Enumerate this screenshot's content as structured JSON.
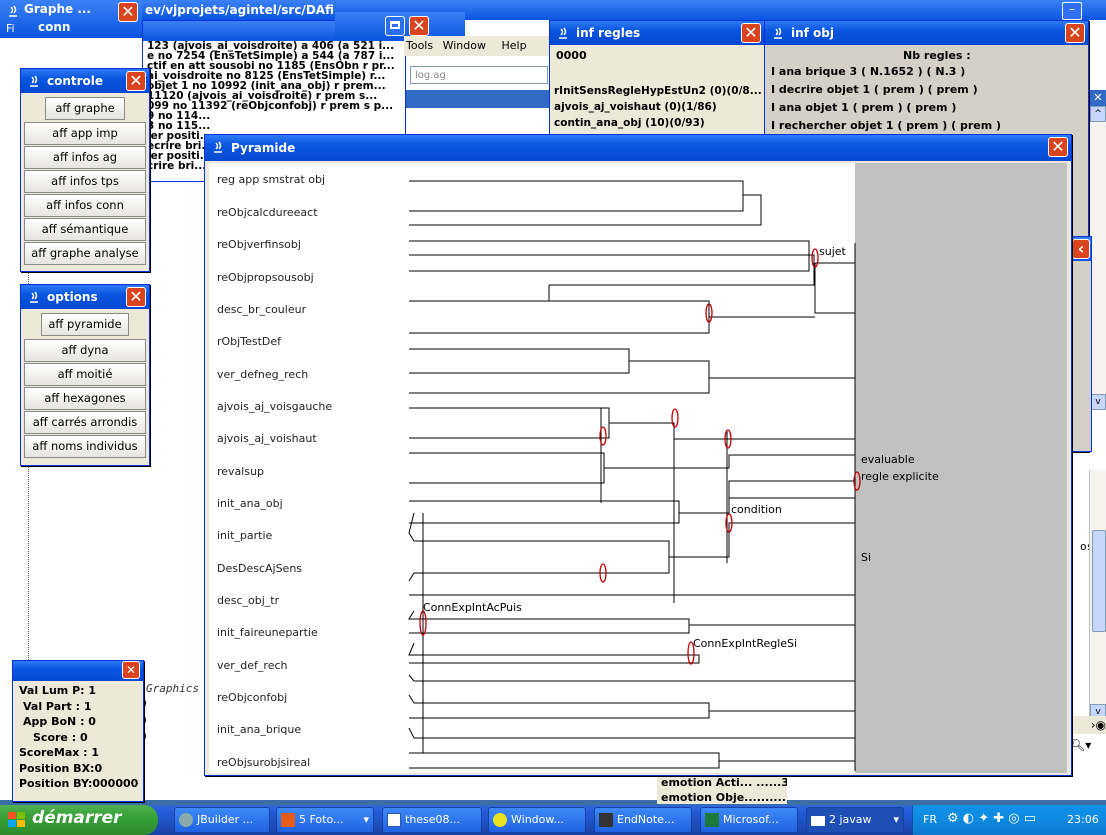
{
  "background_window": {
    "graphe_title": "Graphe ...",
    "path_text": "ev/vjprojets/agintel/src/DAfi",
    "conn_title": "conn",
    "conn_log_lines": [
      "123 (ajvois_ai_voisdroite) a 406 (a 521 i...",
      "e no 7254 (EnsTetSimple) a 544 (a 787 i...",
      "ctif en att sousobi no 1185 (EnsObn r pr...",
      " ai_voisdroite no 8125 (EnsTetSimple) r...",
      "objet 1 no 10992 (init_ana_obj) r prem...",
      "11120 (ajvois_ai_voisdroite) r prem s...",
      "099 no 11392 (reObjconfobj) r prem s p...",
      "9 no 114...",
      "3 no 115...",
      "ler positi...",
      "ecrire bri...",
      "ler positi...",
      "crire bri..."
    ],
    "tools_menu": [
      "Tools",
      "Window",
      "Help"
    ],
    "log_field": "log.ag",
    "fi_label": "Fi",
    "graphics_code": "Graphics g)",
    "code_lines": [
      "0",
      "0",
      "0"
    ],
    "right_code": "osy"
  },
  "inf_regles": {
    "title": "inf regles",
    "header": "0000",
    "lines": [
      "rInitSensRegleHypEstUn2 (0)(0/8...",
      "ajvois_aj_voishaut (0)(1/86)",
      "contin_ana_obj (10)(0/93)"
    ]
  },
  "inf_obj": {
    "title": "inf obj",
    "header": "Nb regles :",
    "lines": [
      "I ana brique 3 ( N.1652 )  ( N.3 )",
      "I decrire objet 1 ( prem )  ( prem )",
      "I ana objet 1 ( prem )  ( prem )",
      "I rechercher objet 1 ( prem )  ( prem )"
    ]
  },
  "controle": {
    "title": "controle",
    "buttons": [
      "aff graphe",
      "aff app imp",
      "aff infos ag",
      "aff infos tps",
      "aff infos conn",
      "aff sémantique",
      "aff graphe analyse"
    ]
  },
  "options": {
    "title": "options",
    "buttons": [
      "aff pyramide",
      "aff dyna",
      "aff moitié",
      "aff hexagones",
      "aff carrés arrondis",
      "aff noms individus"
    ]
  },
  "status_panel": {
    "lines": [
      "Val Lum P: 1",
      "Val Part :  1",
      "App BoN :  0",
      "Score :  0",
      "ScoreMax : 1",
      "Position BX:0",
      "Position BY:000000"
    ]
  },
  "emotion": {
    "lines": [
      "emotion Acti... ......3",
      "emotion Obje.........."
    ]
  },
  "pyramide": {
    "title": "Pyramide",
    "row_labels": [
      "reg app smstrat obj",
      "reObjcalcdureeact",
      "reObjverfinsobj",
      "reObjpropsousobj",
      "desc_br_couleur",
      "rObjTestDef",
      "ver_defneg_rech",
      "ajvois_aj_voisgauche",
      "ajvois_aj_voishaut",
      "revalsup",
      "init_ana_obj",
      "init_partie",
      "DesDescAjSens",
      "desc_obj_tr",
      "init_faireunepartie",
      "ver_def_rech",
      "reObjconfobj",
      "init_ana_brique",
      "reObjsurobjsireal"
    ],
    "node_labels": {
      "sujet": "sujet",
      "evaluable": "evaluable",
      "regle_explicite": "regle explicite",
      "condition": "condition",
      "si": "Si",
      "connexp_acpuis": "ConnExpIntAcPuis",
      "connexp_reglesi": "ConnExpIntRegleSi"
    }
  },
  "taskbar": {
    "start": "démarrer",
    "items": [
      "JBuilder ...",
      "5 Foto...",
      "these08...",
      "Window...",
      "EndNote...",
      "Microsof...",
      "2 javaw"
    ],
    "lang": "FR",
    "clock": "23:06"
  }
}
